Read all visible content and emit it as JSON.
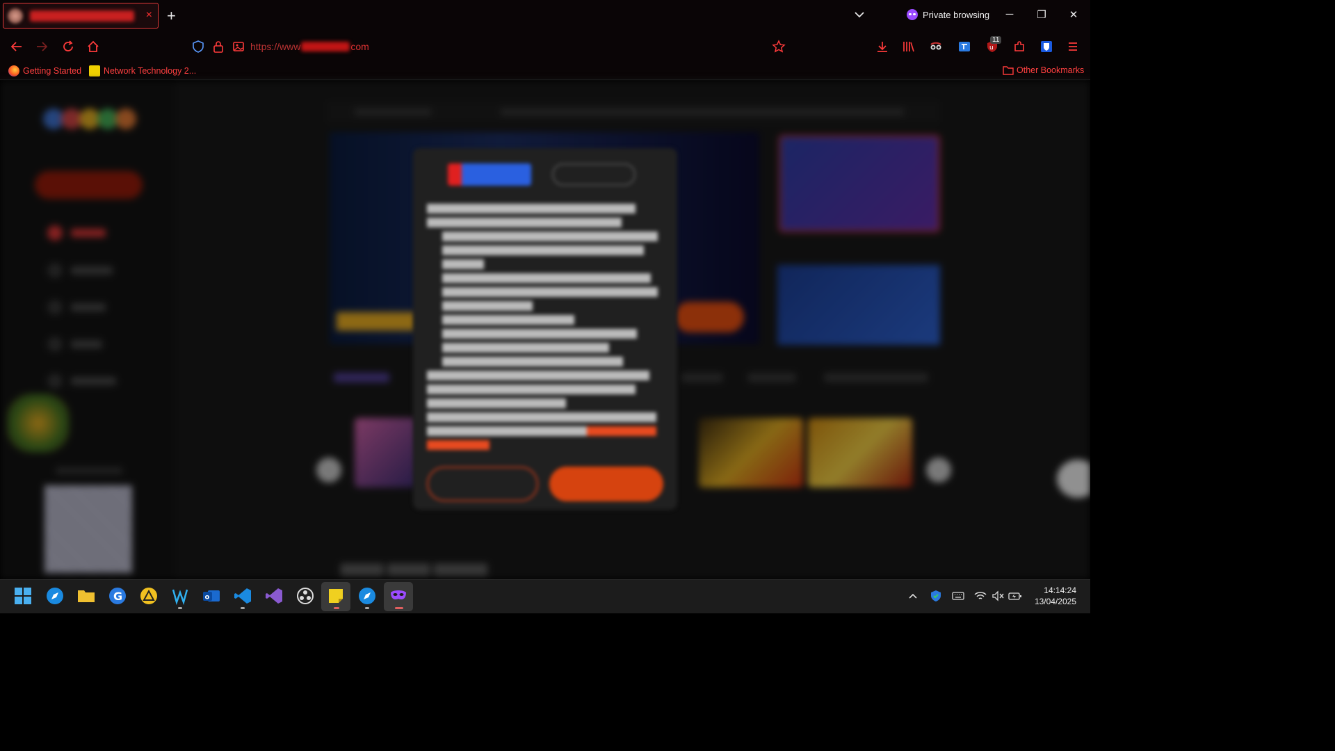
{
  "browser": {
    "tab_close": "×",
    "new_tab": "+",
    "private_label": "Private browsing",
    "minimize": "─",
    "restore": "❐",
    "close": "✕",
    "url_scheme": "https://www",
    "url_tld": "com",
    "extension_badge": "11",
    "accent": "#ff3b3b"
  },
  "bookmarks": {
    "items": [
      {
        "label": "Getting Started"
      },
      {
        "label": "Network Technology 2..."
      }
    ],
    "other": "Other Bookmarks"
  },
  "taskbar": {
    "time": "14:14:24",
    "date": "13/04/2025"
  }
}
